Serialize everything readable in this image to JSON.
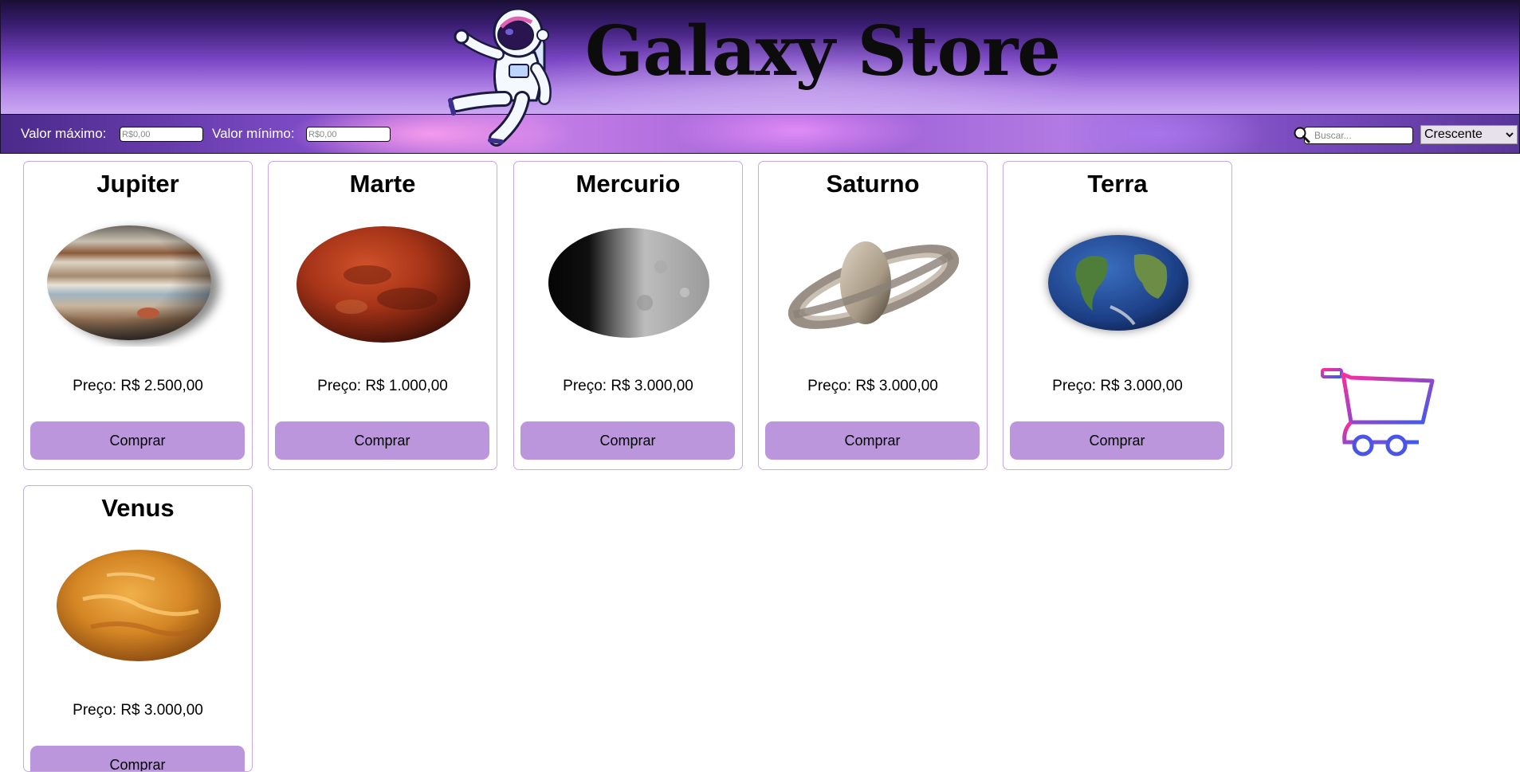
{
  "header": {
    "title": "Galaxy Store",
    "logo_icon": "astronaut-icon"
  },
  "filters": {
    "max_label": "Valor máximo:",
    "max_placeholder": "R$0,00",
    "min_label": "Valor mínimo:",
    "min_placeholder": "R$0,00",
    "search_placeholder": "Buscar...",
    "search_icon": "search-icon",
    "sort_selected": "Crescente"
  },
  "products": [
    {
      "name": "Jupiter",
      "price": "Preço: R$ 2.500,00",
      "buy_label": "Comprar",
      "icon": "jupiter-planet-image"
    },
    {
      "name": "Marte",
      "price": "Preço: R$ 1.000,00",
      "buy_label": "Comprar",
      "icon": "mars-planet-image"
    },
    {
      "name": "Mercurio",
      "price": "Preço: R$ 3.000,00",
      "buy_label": "Comprar",
      "icon": "mercury-planet-image"
    },
    {
      "name": "Saturno",
      "price": "Preço: R$ 3.000,00",
      "buy_label": "Comprar",
      "icon": "saturn-planet-image"
    },
    {
      "name": "Terra",
      "price": "Preço: R$ 3.000,00",
      "buy_label": "Comprar",
      "icon": "earth-planet-image"
    },
    {
      "name": "Venus",
      "price": "Preço: R$ 3.000,00",
      "buy_label": "Comprar",
      "icon": "venus-planet-image"
    }
  ],
  "cart": {
    "icon": "shopping-cart-icon"
  },
  "colors": {
    "button": "#bb96dc",
    "card_border": "#c9a8e6",
    "cart_gradient_start": "#ff2d9a",
    "cart_gradient_end": "#3b5cf0"
  }
}
